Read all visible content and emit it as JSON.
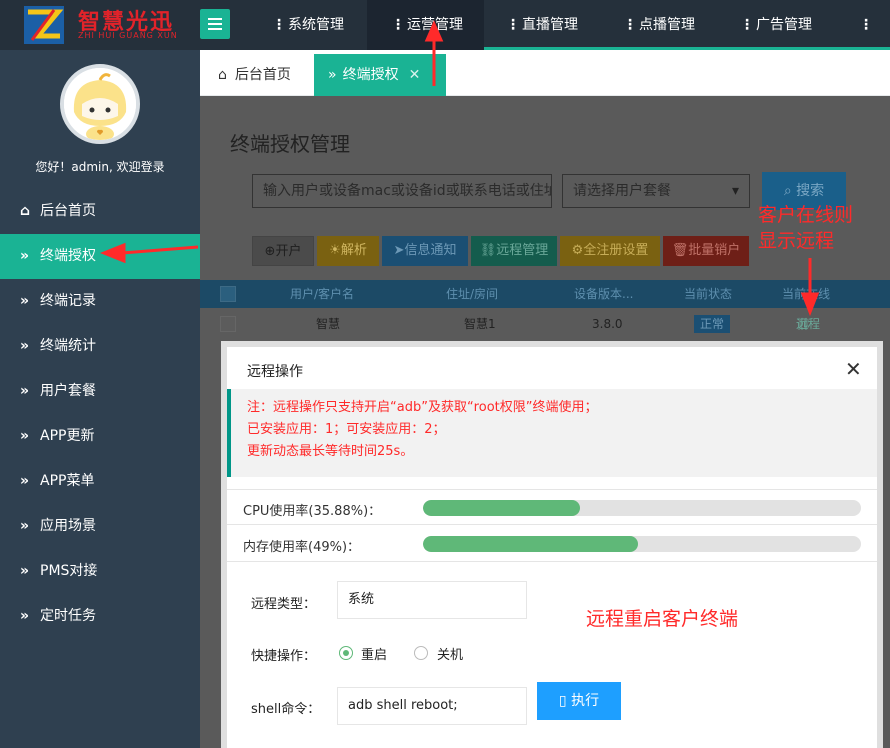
{
  "brand": {
    "title": "智慧光迅",
    "subtitle": "ZHI HUI GUANG XUN"
  },
  "topnav": [
    {
      "label": "系统管理",
      "active": false
    },
    {
      "label": "运营管理",
      "active": true
    },
    {
      "label": "直播管理",
      "active": false
    },
    {
      "label": "点播管理",
      "active": false
    },
    {
      "label": "广告管理",
      "active": false
    }
  ],
  "sidebar": {
    "welcome": "您好！admin, 欢迎登录",
    "items": [
      {
        "label": "后台首页",
        "icon": "home-icon"
      },
      {
        "label": "终端授权",
        "icon": "double-chevron-icon",
        "active": true
      },
      {
        "label": "终端记录",
        "icon": "double-chevron-icon"
      },
      {
        "label": "终端统计",
        "icon": "double-chevron-icon"
      },
      {
        "label": "用户套餐",
        "icon": "double-chevron-icon"
      },
      {
        "label": "APP更新",
        "icon": "double-chevron-icon"
      },
      {
        "label": "APP菜单",
        "icon": "double-chevron-icon"
      },
      {
        "label": "应用场景",
        "icon": "double-chevron-icon"
      },
      {
        "label": "PMS对接",
        "icon": "double-chevron-icon"
      },
      {
        "label": "定时任务",
        "icon": "double-chevron-icon"
      }
    ]
  },
  "tabs": {
    "home": "后台首页",
    "current": "终端授权",
    "close": "✕"
  },
  "panel": {
    "title": "终端授权管理",
    "search_placeholder": "输入用户或设备mac或设备id或联系电话或住址",
    "package_placeholder": "请选择用户套餐",
    "search_label": "搜索"
  },
  "toolbar": [
    {
      "label": "开户",
      "bg": "#4b4b4b",
      "fg": "#1e1e1e"
    },
    {
      "label": "解析",
      "bg": "#7a6111",
      "fg": "#d0b660"
    },
    {
      "label": "信息通知",
      "bg": "#1b4f73",
      "fg": "#6d99b7"
    },
    {
      "label": "远程管理",
      "bg": "#145c4d",
      "fg": "#6aa899"
    },
    {
      "label": "全注册设置",
      "bg": "#7a6111",
      "fg": "#c7ad58"
    },
    {
      "label": "批量销户",
      "bg": "#6e1f17",
      "fg": "#c07268"
    }
  ],
  "table": {
    "headers": [
      "用户/客户名",
      "住址/房间",
      "设备版本...",
      "当前状态",
      "当前在线"
    ],
    "row": {
      "user": "智慧",
      "address": "智慧1",
      "version": "3.8.0",
      "status": "正常",
      "action": "远程"
    }
  },
  "annotations": {
    "remote_online_line1": "客户在线则",
    "remote_online_line2": "显示远程",
    "reboot": "远程重启客户终端"
  },
  "modal": {
    "title": "远程操作",
    "close": "✕",
    "notice": [
      "注：远程操作只支持开启“adb”及获取“root权限”终端使用；",
      "已安装应用：1；可安装应用：2；",
      "更新动态最长等待时间25s。"
    ],
    "cpu_label": "CPU使用率(35.88%)：",
    "cpu_percent": 35.88,
    "mem_label": "内存使用率(49%)：",
    "mem_percent": 49,
    "remote_type_label": "远程类型：",
    "remote_type_value": "系统",
    "quick_label": "快捷操作：",
    "quick_options": [
      "重启",
      "关机"
    ],
    "quick_selected": "重启",
    "shell_label": "shell命令：",
    "shell_value": "adb shell reboot;",
    "exec_label": "执行"
  },
  "colors": {
    "accent": "#1ab394",
    "annotation": "#ff2a2a",
    "progress": "#5fb878",
    "exec": "#1e9fff"
  }
}
